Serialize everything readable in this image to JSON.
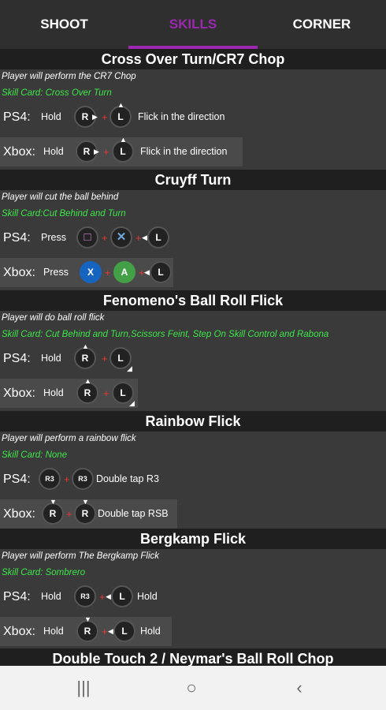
{
  "tabs": [
    {
      "label": "SHOOT",
      "active": false
    },
    {
      "label": "SKILLS",
      "active": true
    },
    {
      "label": "CORNER",
      "active": false
    }
  ],
  "accent": "#9c27b0",
  "sections": [
    {
      "title": "Cross Over Turn/CR7 Chop",
      "description": "Player will perform the CR7 Chop",
      "card": "Skill Card: Cross Over Turn",
      "ps4": {
        "platform": "PS4:",
        "action": "Hold",
        "note": "Flick in the direction"
      },
      "xbox": {
        "platform": "Xbox:",
        "action": "Hold",
        "note": "Flick in the direction"
      }
    },
    {
      "title": "Cruyff Turn",
      "description": "Player will cut the ball behind",
      "card": "Skill Card:Cut Behind and Turn",
      "ps4": {
        "platform": "PS4:",
        "action": "Press",
        "note": ""
      },
      "xbox": {
        "platform": "Xbox:",
        "action": "Press",
        "note": ""
      }
    },
    {
      "title": "Fenomeno's Ball Roll Flick",
      "description": "Player will do ball roll flick",
      "card": "Skill Card: Cut Behind and Turn,Scissors Feint, Step On Skill Control and Rabona",
      "ps4": {
        "platform": "PS4:",
        "action": "Hold",
        "note": ""
      },
      "xbox": {
        "platform": "Xbox:",
        "action": "Hold",
        "note": ""
      }
    },
    {
      "title": "Rainbow Flick",
      "description": "Player will perform a rainbow flick",
      "card": "Skill Card: None",
      "ps4": {
        "platform": "PS4:",
        "action": "",
        "note": "Double tap R3"
      },
      "xbox": {
        "platform": "Xbox:",
        "action": "",
        "note": "Double tap RSB"
      }
    },
    {
      "title": "Bergkamp Flick",
      "description": "Player will perform The Bergkamp Flick",
      "card": "Skill Card: Sombrero",
      "ps4": {
        "platform": "PS4:",
        "action": "Hold",
        "note": "Hold"
      },
      "xbox": {
        "platform": "Xbox:",
        "action": "Hold",
        "note": "Hold"
      }
    },
    {
      "title": "Double Touch 2 / Neymar's Ball Roll Chop"
    }
  ],
  "buttons": {
    "r": "R",
    "l": "L",
    "r3": "R3",
    "square": "□",
    "cross": "✕",
    "x": "X",
    "a": "A"
  },
  "icons": {
    "recents": "recents-icon",
    "home": "home-icon",
    "back": "back-icon"
  },
  "nav": {
    "recents": "|||",
    "home": "○",
    "back": "‹"
  }
}
